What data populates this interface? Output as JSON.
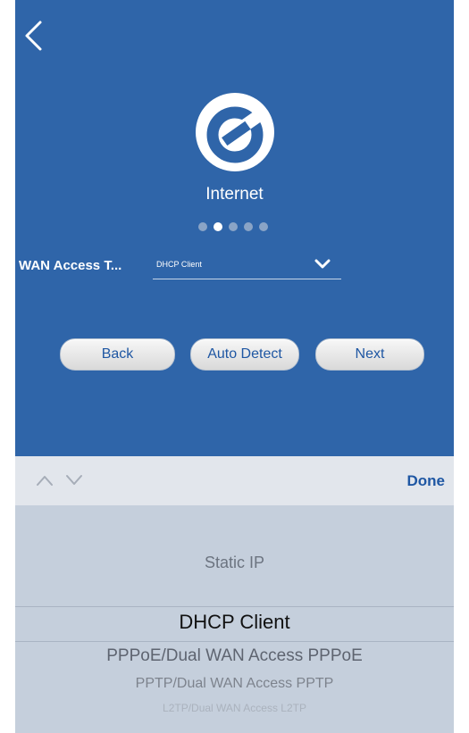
{
  "colors": {
    "header_bg": "#2f65a9",
    "button_text": "#1f57a3",
    "picker_bg": "#c5cfdc"
  },
  "header": {
    "back_icon": "chevron-left-icon",
    "logo_icon": "internet-e-logo-icon",
    "title": "Internet"
  },
  "progress": {
    "total_steps": 5,
    "current_step": 2
  },
  "wan": {
    "label": "WAN Access T...",
    "value": "DHCP Client",
    "dropdown_icon": "chevron-down-icon"
  },
  "buttons": {
    "back": "Back",
    "auto_detect": "Auto Detect",
    "next": "Next"
  },
  "toolbar": {
    "prev_icon": "chevron-up-icon",
    "next_icon": "chevron-down-icon",
    "done": "Done"
  },
  "picker": {
    "options": [
      "Static IP",
      "DHCP Client",
      "PPPoE/Dual WAN Access PPPoE",
      "PPTP/Dual WAN Access PPTP",
      "L2TP/Dual WAN Access L2TP"
    ],
    "selected_index": 1
  }
}
